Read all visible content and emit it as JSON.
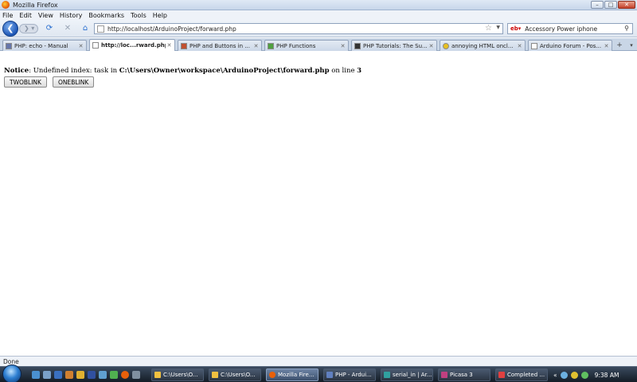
{
  "window": {
    "title": "Mozilla Firefox",
    "min": "–",
    "max": "□",
    "close": "✕"
  },
  "menu": [
    "File",
    "Edit",
    "View",
    "History",
    "Bookmarks",
    "Tools",
    "Help"
  ],
  "nav": {
    "url": "http://localhost/ArduinoProject/forward.php",
    "search_engine": "eBay",
    "search_text": "Accessory Power iphone"
  },
  "tabs": [
    {
      "label": "PHP: echo - Manual",
      "active": false
    },
    {
      "label": "http://loc...rward.php",
      "active": true
    },
    {
      "label": "PHP and Buttons in ...",
      "active": false
    },
    {
      "label": "PHP Functions",
      "active": false
    },
    {
      "label": "PHP Tutorials: The Su...",
      "active": false
    },
    {
      "label": "annoying HTML oncl...",
      "active": false
    },
    {
      "label": "Arduino Forum - Pos...",
      "active": false
    }
  ],
  "content": {
    "notice_label": "Notice",
    "notice_text": ": Undefined index: task in ",
    "notice_path": "C:\\Users\\Owner\\workspace\\ArduinoProject\\forward.php",
    "notice_online": " on line ",
    "notice_line": "3",
    "buttons": [
      "TWOBLINK",
      "ONEBLINK"
    ]
  },
  "status": "Done",
  "taskbar": {
    "items": [
      {
        "label": "C:\\Users\\O...",
        "active": false,
        "color": "#f0c040"
      },
      {
        "label": "C:\\Users\\O...",
        "active": false,
        "color": "#f0c040"
      },
      {
        "label": "Mozilla Fire...",
        "active": true,
        "color": "#e8600a"
      },
      {
        "label": "PHP - Ardui...",
        "active": false,
        "color": "#6080c0"
      },
      {
        "label": "serial_in | Ar...",
        "active": false,
        "color": "#30a0a0"
      },
      {
        "label": "Picasa 3",
        "active": false,
        "color": "#c04080"
      },
      {
        "label": "Completed ...",
        "active": false,
        "color": "#e04040"
      }
    ],
    "clock": "9:38 AM"
  }
}
